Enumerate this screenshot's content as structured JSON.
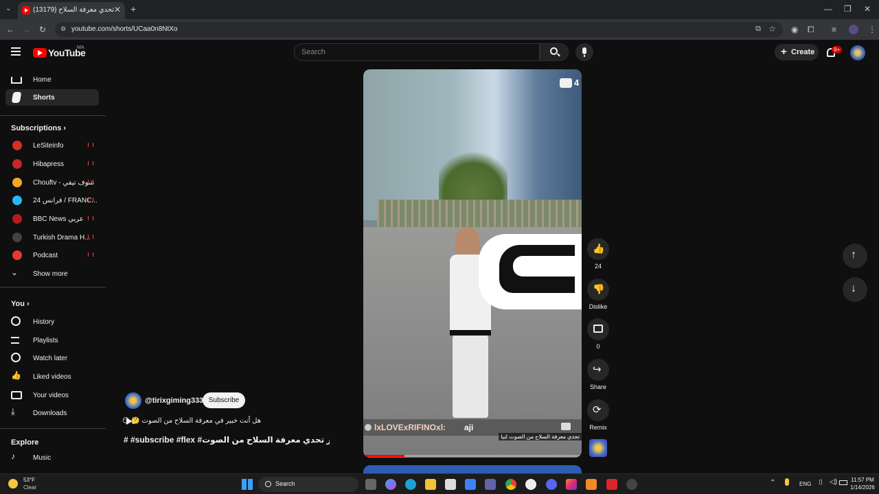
{
  "browser": {
    "tab_title": "(13179) تحدي معرفة السلاح",
    "url": "youtube.com/shorts/UCaa0n8NtXo"
  },
  "header": {
    "logo_text": "YouTube",
    "country": "MA",
    "search_placeholder": "Search",
    "create_label": "Create",
    "notif_badge": "9+"
  },
  "sidebar": {
    "home": "Home",
    "shorts": "Shorts",
    "subscriptions": "Subscriptions",
    "channels": [
      {
        "name": "LeSiteinfo",
        "color": "#d93025"
      },
      {
        "name": "Hibapress",
        "color": "#c62828"
      },
      {
        "name": "Chouftv - شوف تيفي",
        "color": "#f5a623"
      },
      {
        "name": "24 فرانس / FRANC...",
        "color": "#29b6f6"
      },
      {
        "name": "BBC News عربي",
        "color": "#b71c1c"
      },
      {
        "name": "Turkish Drama H...",
        "color": "#424242"
      },
      {
        "name": "Podcast",
        "color": "#e53935"
      }
    ],
    "show_more": "Show more",
    "you": "You",
    "you_items": [
      "History",
      "Playlists",
      "Watch later",
      "Liked videos",
      "Your videos",
      "Downloads"
    ],
    "explore": "Explore",
    "explore_items": [
      "Music"
    ]
  },
  "video": {
    "overlay_user": "lxLOVExRIFINOxl:",
    "overlay_msg": "aji",
    "corner_count": "4",
    "bottom_caption": "تحدي معرفة السلاح من الصوت لنيا",
    "channel": "@tirixgiming333",
    "subscribe": "Subscribe",
    "desc": "هل أنت خبير في معرفة السلاح من الصوت 🤔 😏",
    "title": "# #subscribe #flex #اكسبلور تحدي معرفة السلاح من الصوت..."
  },
  "actions": {
    "likes": "24",
    "dislike": "Dislike",
    "comments": "0",
    "share": "Share",
    "remix": "Remix"
  },
  "taskbar": {
    "weather_temp": "53°F",
    "weather_desc": "Clear",
    "search": "Search",
    "lang": "ENG",
    "time": "11:57 PM",
    "date": "1/14/2026"
  }
}
